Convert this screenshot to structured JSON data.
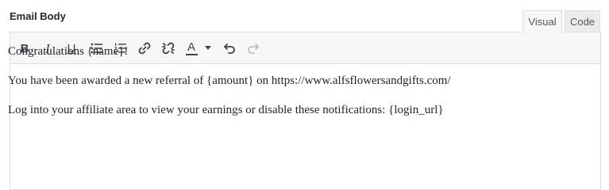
{
  "field": {
    "label": "Email Body"
  },
  "tabs": {
    "visual": "Visual",
    "code": "Code",
    "active": "visual"
  },
  "toolbar": {
    "bold_glyph": "B",
    "italic_glyph": "I",
    "underline_glyph": "U",
    "text_color_glyph": "A",
    "text_color_swatch": "#3c434a",
    "icons": [
      "bold-icon",
      "italic-icon",
      "underline-icon",
      "bullet-list-icon",
      "numbered-list-icon",
      "link-icon",
      "unlink-icon",
      "text-color-icon",
      "dropdown-arrow-icon",
      "undo-icon",
      "redo-icon"
    ],
    "redo_enabled": false
  },
  "content": {
    "paragraphs": [
      "Congratulations {name}!",
      "You have been awarded a new referral of {amount} on https://www.alfsflowersandgifts.com/",
      "Log into your affiliate area to view your earnings or disable these notifications: {login_url}"
    ]
  }
}
